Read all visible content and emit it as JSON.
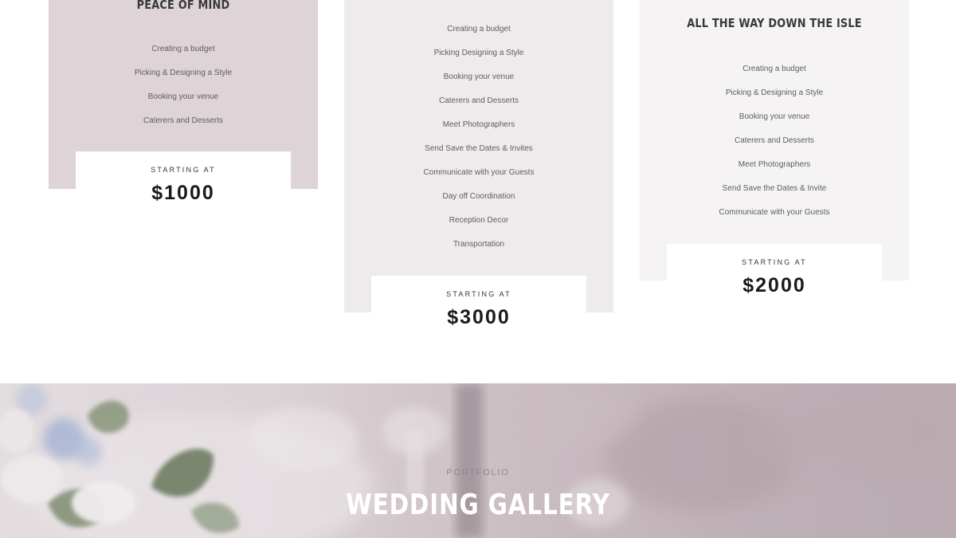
{
  "pricing": {
    "cards": [
      {
        "title": "PEACE OF MIND",
        "features": [
          "Creating a budget",
          "Picking & Designing a Style",
          "Booking your venue",
          "Caterers and Desserts"
        ],
        "price_label": "STARTING AT",
        "price": "$1000"
      },
      {
        "title": "",
        "features": [
          "Creating a budget",
          "Picking Designing a Style",
          "Booking your venue",
          "Caterers and Desserts",
          "Meet Photographers",
          "Send Save the Dates & Invites",
          "Communicate with your Guests",
          "Day off Coordination",
          "Reception Decor",
          "Transportation"
        ],
        "price_label": "STARTING AT",
        "price": "$3000"
      },
      {
        "title": "ALL THE WAY DOWN THE ISLE",
        "features": [
          "Creating a budget",
          "Picking & Designing a Style",
          "Booking your venue",
          "Caterers and Desserts",
          "Meet Photographers",
          "Send Save the Dates & Invite",
          "Communicate with your Guests"
        ],
        "price_label": "STARTING AT",
        "price": "$2000"
      }
    ]
  },
  "gallery": {
    "kicker": "PORTFOLIO",
    "title": "WEDDING GALLERY"
  }
}
